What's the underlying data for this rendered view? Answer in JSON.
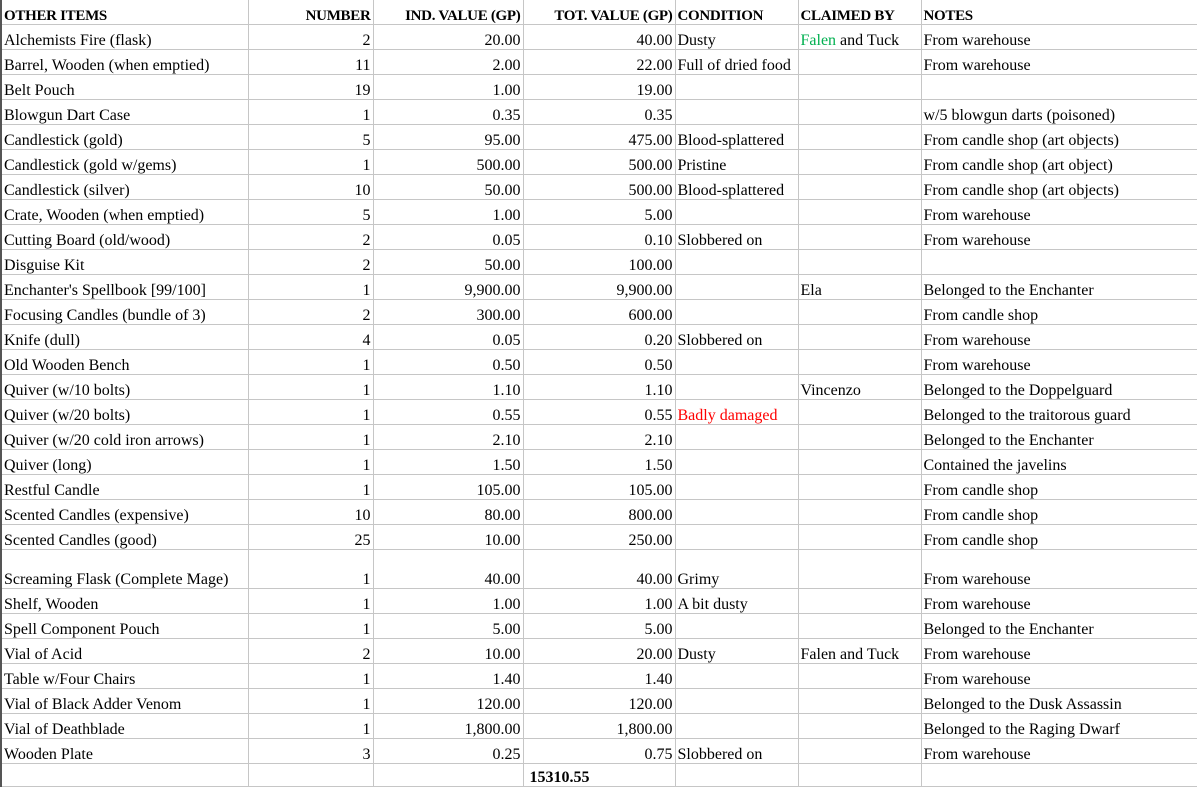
{
  "header": {
    "name": "OTHER ITEMS",
    "number": "NUMBER",
    "ind_value": "IND. VALUE (GP)",
    "tot_value": "TOT. VALUE (GP)",
    "condition": "CONDITION",
    "claimed_by": "CLAIMED BY",
    "notes": "NOTES"
  },
  "colors": {
    "claimed_highlight": "#00b050",
    "condition_alert": "#ff0000",
    "gridline": "#c6c6c6"
  },
  "rows": [
    {
      "name": "Alchemists Fire (flask)",
      "number": "2",
      "ind": "20.00",
      "tot": "40.00",
      "condition": "Dusty",
      "claimed_green": "Falen",
      "claimed_rest": " and Tuck",
      "notes": "From warehouse"
    },
    {
      "name": "Barrel, Wooden (when emptied)",
      "number": "11",
      "ind": "2.00",
      "tot": "22.00",
      "condition": "Full of dried food",
      "claimed": "",
      "notes": "From warehouse"
    },
    {
      "name": "Belt Pouch",
      "number": "19",
      "ind": "1.00",
      "tot": "19.00",
      "condition": "",
      "claimed": "",
      "notes": ""
    },
    {
      "name": "Blowgun Dart Case",
      "number": "1",
      "ind": "0.35",
      "tot": "0.35",
      "condition": "",
      "claimed": "",
      "notes": "w/5 blowgun darts (poisoned)"
    },
    {
      "name": "Candlestick (gold)",
      "number": "5",
      "ind": "95.00",
      "tot": "475.00",
      "condition": "Blood-splattered",
      "claimed": "",
      "notes": "From candle shop (art objects)"
    },
    {
      "name": "Candlestick (gold w/gems)",
      "number": "1",
      "ind": "500.00",
      "tot": "500.00",
      "condition": "Pristine",
      "claimed": "",
      "notes": "From candle shop (art object)"
    },
    {
      "name": "Candlestick (silver)",
      "number": "10",
      "ind": "50.00",
      "tot": "500.00",
      "condition": "Blood-splattered",
      "claimed": "",
      "notes": "From candle shop (art objects)"
    },
    {
      "name": "Crate, Wooden (when emptied)",
      "number": "5",
      "ind": "1.00",
      "tot": "5.00",
      "condition": "",
      "claimed": "",
      "notes": "From warehouse"
    },
    {
      "name": "Cutting Board (old/wood)",
      "number": "2",
      "ind": "0.05",
      "tot": "0.10",
      "condition": "Slobbered on",
      "claimed": "",
      "notes": "From warehouse"
    },
    {
      "name": "Disguise Kit",
      "number": "2",
      "ind": "50.00",
      "tot": "100.00",
      "condition": "",
      "claimed": "",
      "notes": ""
    },
    {
      "name": "Enchanter's Spellbook [99/100]",
      "number": "1",
      "ind": "9,900.00",
      "tot": "9,900.00",
      "condition": "",
      "claimed": "Ela",
      "notes": "Belonged to the Enchanter"
    },
    {
      "name": "Focusing Candles (bundle of 3)",
      "number": "2",
      "ind": "300.00",
      "tot": "600.00",
      "condition": "",
      "claimed": "",
      "notes": "From candle shop"
    },
    {
      "name": "Knife (dull)",
      "number": "4",
      "ind": "0.05",
      "tot": "0.20",
      "condition": "Slobbered on",
      "claimed": "",
      "notes": "From warehouse"
    },
    {
      "name": "Old Wooden Bench",
      "number": "1",
      "ind": "0.50",
      "tot": "0.50",
      "condition": "",
      "claimed": "",
      "notes": "From warehouse"
    },
    {
      "name": "Quiver (w/10 bolts)",
      "number": "1",
      "ind": "1.10",
      "tot": "1.10",
      "condition": "",
      "claimed": "Vincenzo",
      "notes": "Belonged to the Doppelguard"
    },
    {
      "name": "Quiver (w/20 bolts)",
      "number": "1",
      "ind": "0.55",
      "tot": "0.55",
      "condition": "Badly damaged",
      "condition_red": true,
      "claimed": "",
      "notes": "Belonged to the traitorous guard"
    },
    {
      "name": "Quiver (w/20 cold iron arrows)",
      "number": "1",
      "ind": "2.10",
      "tot": "2.10",
      "condition": "",
      "claimed": "",
      "notes": "Belonged to the Enchanter"
    },
    {
      "name": "Quiver (long)",
      "number": "1",
      "ind": "1.50",
      "tot": "1.50",
      "condition": "",
      "claimed": "",
      "notes": "Contained the javelins"
    },
    {
      "name": "Restful Candle",
      "number": "1",
      "ind": "105.00",
      "tot": "105.00",
      "condition": "",
      "claimed": "",
      "notes": "From candle shop"
    },
    {
      "name": "Scented Candles (expensive)",
      "number": "10",
      "ind": "80.00",
      "tot": "800.00",
      "condition": "",
      "claimed": "",
      "notes": "From candle shop"
    },
    {
      "name": "Scented Candles (good)",
      "number": "25",
      "ind": "10.00",
      "tot": "250.00",
      "condition": "",
      "claimed": "",
      "notes": "From candle shop"
    },
    {
      "name": "Screaming Flask (Complete Mage)",
      "number": "1",
      "ind": "40.00",
      "tot": "40.00",
      "condition": "Grimy",
      "claimed": "",
      "notes": "From warehouse",
      "tall": true
    },
    {
      "name": "Shelf, Wooden",
      "number": "1",
      "ind": "1.00",
      "tot": "1.00",
      "condition": "A bit dusty",
      "claimed": "",
      "notes": "From warehouse"
    },
    {
      "name": "Spell Component Pouch",
      "number": "1",
      "ind": "5.00",
      "tot": "5.00",
      "condition": "",
      "claimed": "",
      "notes": "Belonged to the Enchanter"
    },
    {
      "name": "Vial of Acid",
      "number": "2",
      "ind": "10.00",
      "tot": "20.00",
      "condition": "Dusty",
      "claimed": "Falen and Tuck",
      "notes": "From warehouse"
    },
    {
      "name": "Table w/Four Chairs",
      "number": "1",
      "ind": "1.40",
      "tot": "1.40",
      "condition": "",
      "claimed": "",
      "notes": "From warehouse"
    },
    {
      "name": "Vial of Black Adder Venom",
      "number": "1",
      "ind": "120.00",
      "tot": "120.00",
      "condition": "",
      "claimed": "",
      "notes": "Belonged to the Dusk Assassin"
    },
    {
      "name": "Vial of Deathblade",
      "number": "1",
      "ind": "1,800.00",
      "tot": "1,800.00",
      "condition": "",
      "claimed": "",
      "notes": "Belonged to the Raging Dwarf"
    },
    {
      "name": "Wooden Plate",
      "number": "3",
      "ind": "0.25",
      "tot": "0.75",
      "condition": "Slobbered on",
      "claimed": "",
      "notes": "From warehouse"
    }
  ],
  "total": {
    "tot": "15310.55"
  }
}
